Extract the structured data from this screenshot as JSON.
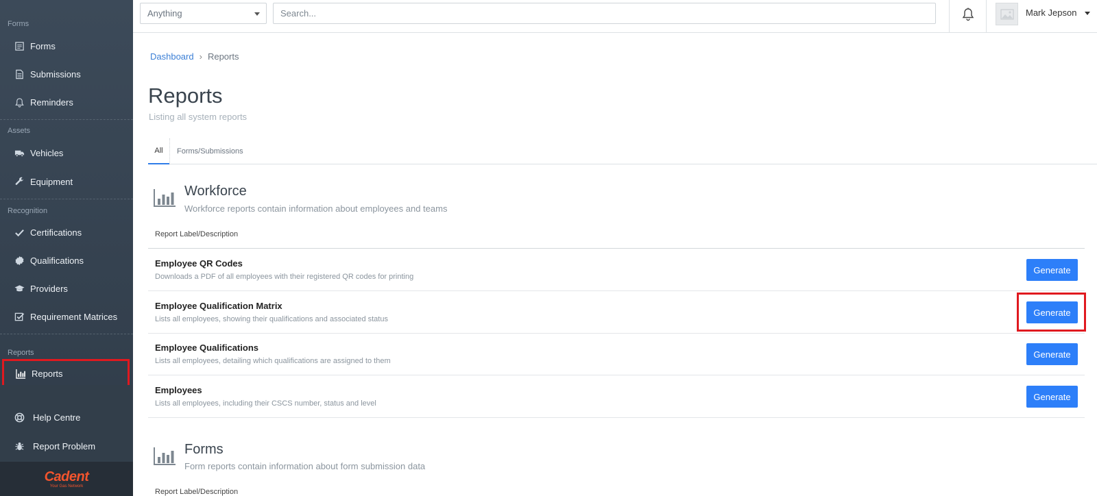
{
  "sidebar": {
    "sections": [
      {
        "label": "Forms",
        "items": [
          {
            "label": "Forms",
            "icon": "forms-icon"
          },
          {
            "label": "Submissions",
            "icon": "document-icon"
          },
          {
            "label": "Reminders",
            "icon": "bell-icon"
          }
        ]
      },
      {
        "label": "Assets",
        "items": [
          {
            "label": "Vehicles",
            "icon": "truck-icon"
          },
          {
            "label": "Equipment",
            "icon": "wrench-icon"
          }
        ]
      },
      {
        "label": "Recognition",
        "items": [
          {
            "label": "Certifications",
            "icon": "check-icon"
          },
          {
            "label": "Qualifications",
            "icon": "badge-icon"
          },
          {
            "label": "Providers",
            "icon": "graduation-cap-icon"
          },
          {
            "label": "Requirement Matrices",
            "icon": "checkbox-icon"
          }
        ]
      },
      {
        "label": "Reports",
        "items": [
          {
            "label": "Reports",
            "icon": "bar-chart-icon",
            "active": true
          }
        ]
      }
    ],
    "bottom": [
      {
        "label": "Help Centre",
        "icon": "lifebuoy-icon"
      },
      {
        "label": "Report Problem",
        "icon": "bug-icon"
      }
    ],
    "logo": {
      "name": "Cadent",
      "tagline": "Your Gas Network",
      "color": "#f2542d"
    }
  },
  "topbar": {
    "scope_select": "Anything",
    "search_placeholder": "Search...",
    "user_name": "Mark Jepson"
  },
  "breadcrumb": {
    "home": "Dashboard",
    "current": "Reports"
  },
  "page": {
    "title": "Reports",
    "subtitle": "Listing all system reports"
  },
  "tabs": [
    {
      "label": "All",
      "active": true
    },
    {
      "label": "Forms/Submissions"
    }
  ],
  "sections": [
    {
      "title": "Workforce",
      "description": "Workforce reports contain information about employees and teams",
      "column_header": "Report Label/Description",
      "reports": [
        {
          "title": "Employee QR Codes",
          "description": "Downloads a PDF of all employees with their registered QR codes for printing",
          "button": "Generate"
        },
        {
          "title": "Employee Qualification Matrix",
          "description": "Lists all employees, showing their qualifications and associated status",
          "button": "Generate"
        },
        {
          "title": "Employee Qualifications",
          "description": "Lists all employees, detailing which qualifications are assigned to them",
          "button": "Generate"
        },
        {
          "title": "Employees",
          "description": "Lists all employees, including their CSCS number, status and level",
          "button": "Generate"
        }
      ]
    },
    {
      "title": "Forms",
      "description": "Form reports contain information about form submission data",
      "column_header": "Report Label/Description"
    }
  ],
  "colors": {
    "accent": "#2d7ff9",
    "highlight": "#e0191f",
    "sidebar": "#364351"
  }
}
